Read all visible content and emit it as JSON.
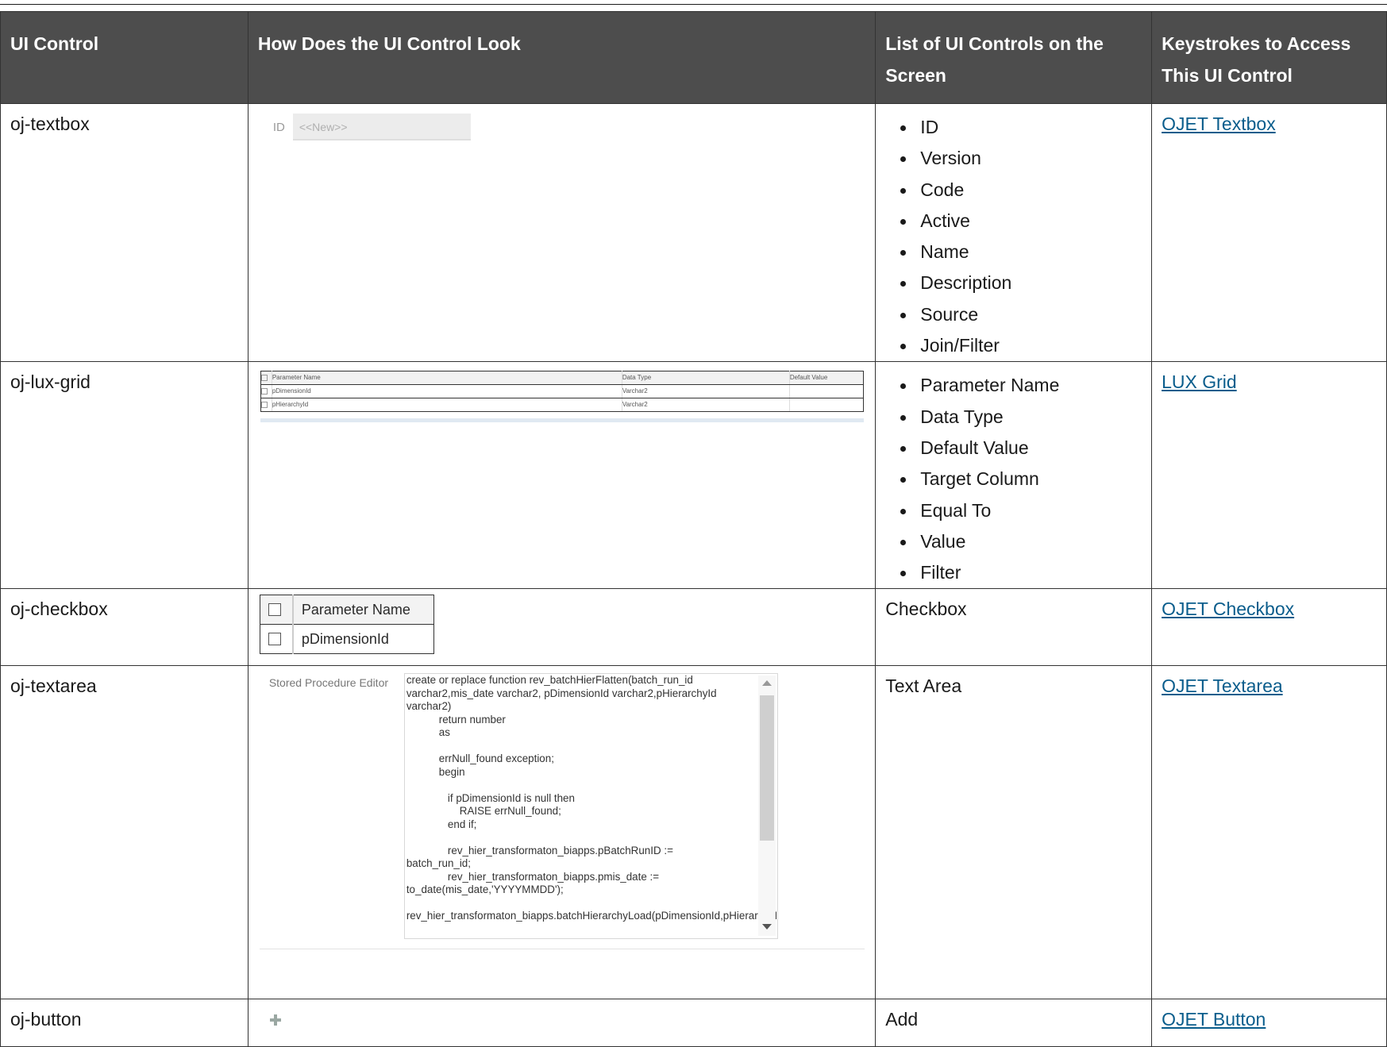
{
  "headers": [
    "UI Control",
    "How Does the UI Control Look",
    "List of UI Controls on the Screen",
    "Keystrokes to Access This UI Control"
  ],
  "rows": [
    {
      "control": "oj-textbox",
      "controls_list": [
        "ID",
        "Version",
        "Code",
        "Active",
        "Name",
        "Description",
        "Source",
        "Join/Filter"
      ],
      "link": "OJET Textbox",
      "sample": {
        "label": "ID",
        "placeholder": "<<New>>"
      }
    },
    {
      "control": "oj-lux-grid",
      "controls_list": [
        "Parameter Name",
        "Data Type",
        "Default Value",
        "Target Column",
        "Equal To",
        "Value",
        "Filter"
      ],
      "link": "LUX Grid",
      "sample": {
        "columns": [
          "Parameter Name",
          "Data Type",
          "Default Value"
        ],
        "rows": [
          [
            "pDimensionId",
            "Varchar2",
            ""
          ],
          [
            "pHierarchyId",
            "Varchar2",
            ""
          ]
        ]
      }
    },
    {
      "control": "oj-checkbox",
      "controls_text": "Checkbox",
      "link": "OJET Checkbox",
      "sample": {
        "header": "Parameter Name",
        "row": "pDimensionId"
      }
    },
    {
      "control": "oj-textarea",
      "controls_text": "Text Area",
      "link": "OJET Textarea",
      "sample": {
        "label": "Stored Procedure Editor",
        "code": "create or replace function rev_batchHierFlatten(batch_run_id varchar2,mis_date varchar2, pDimensionId varchar2,pHierarchyId varchar2)\n           return number\n           as\n\n           errNull_found exception;\n           begin\n\n              if pDimensionId is null then\n                  RAISE errNull_found;\n              end if;\n\n              rev_hier_transformaton_biapps.pBatchRunID :=\nbatch_run_id;\n              rev_hier_transformaton_biapps.pmis_date :=\nto_date(mis_date,'YYYYMMDD');\n\nrev_hier_transformaton_biapps.batchHierarchyLoad(pDimensionId,pHierarchyId);"
      }
    },
    {
      "control": "oj-button",
      "controls_text": "Add",
      "link": "OJET Button"
    }
  ]
}
